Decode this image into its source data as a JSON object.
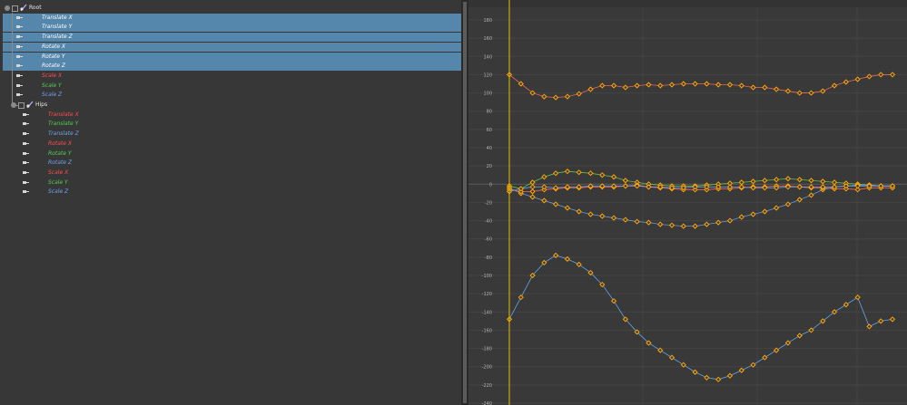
{
  "outliner": {
    "nodes": [
      {
        "name": "Root",
        "channels": [
          {
            "label": "Translate X",
            "axis": "x",
            "selected": true
          },
          {
            "label": "Translate Y",
            "axis": "y",
            "selected": true
          },
          {
            "label": "Translate Z",
            "axis": "z",
            "selected": true
          },
          {
            "label": "Rotate X",
            "axis": "x",
            "selected": true
          },
          {
            "label": "Rotate Y",
            "axis": "y",
            "selected": true
          },
          {
            "label": "Rotate Z",
            "axis": "z",
            "selected": true
          },
          {
            "label": "Scale X",
            "axis": "x",
            "selected": false
          },
          {
            "label": "Scale Y",
            "axis": "y",
            "selected": false
          },
          {
            "label": "Scale Z",
            "axis": "z",
            "selected": false
          }
        ]
      },
      {
        "name": "Hips",
        "channels": [
          {
            "label": "Translate X",
            "axis": "x",
            "selected": false
          },
          {
            "label": "Translate Y",
            "axis": "y",
            "selected": false
          },
          {
            "label": "Translate Z",
            "axis": "z",
            "selected": false
          },
          {
            "label": "Rotate X",
            "axis": "x",
            "selected": false
          },
          {
            "label": "Rotate Y",
            "axis": "y",
            "selected": false
          },
          {
            "label": "Rotate Z",
            "axis": "z",
            "selected": false
          },
          {
            "label": "Scale X",
            "axis": "x",
            "selected": false
          },
          {
            "label": "Scale Y",
            "axis": "y",
            "selected": false
          },
          {
            "label": "Scale Z",
            "axis": "z",
            "selected": false
          }
        ]
      }
    ],
    "colors": {
      "x": "#ff4e4e",
      "y": "#53ce53",
      "z": "#6fa3ef",
      "selection": "#5586ac"
    }
  },
  "graph_editor": {
    "y_ticks": [
      "180",
      "160",
      "140",
      "120",
      "100",
      "80",
      "60",
      "40",
      "20",
      "0",
      "-20",
      "-40",
      "-60",
      "-80",
      "-100",
      "-120",
      "-140",
      "-160",
      "-180",
      "-200",
      "-220",
      "-240"
    ],
    "current_frame_color": "#e8c000",
    "key_color": "#ffa500",
    "frames": [
      0,
      1,
      2,
      3,
      4,
      5,
      6,
      7,
      8,
      9,
      10,
      11,
      12,
      13,
      14,
      15,
      16,
      17,
      18,
      19,
      20,
      21,
      22,
      23,
      24,
      25,
      26,
      27,
      28,
      29,
      30,
      31,
      32,
      33
    ],
    "curves": [
      {
        "name": "Rotate Y",
        "color": "#69b0ff",
        "values": [
          -148,
          -124,
          -100,
          -86,
          -78,
          -82,
          -88,
          -97,
          -110,
          -128,
          -148,
          -162,
          -174,
          -182,
          -190,
          -198,
          -206,
          -212,
          -214,
          -210,
          -204,
          -198,
          -190,
          -182,
          -174,
          -166,
          -160,
          -150,
          -140,
          -132,
          -124,
          -156,
          -150,
          -148
        ]
      },
      {
        "name": "Rotate X",
        "color": "#ff6a6a",
        "values": [
          120,
          110,
          100,
          96,
          95,
          96,
          99,
          104,
          108,
          108,
          106,
          108,
          109,
          108,
          109,
          110,
          110,
          110,
          109,
          109,
          108,
          106,
          106,
          104,
          102,
          100,
          100,
          102,
          108,
          112,
          115,
          118,
          120,
          120
        ]
      },
      {
        "name": "Translate Y",
        "color": "#5fd25f",
        "values": [
          -2,
          -5,
          2,
          8,
          12,
          14,
          13,
          12,
          10,
          8,
          4,
          2,
          0,
          -1,
          -2,
          -2,
          -2,
          -1,
          0,
          1,
          2,
          3,
          4,
          5,
          6,
          5,
          4,
          3,
          2,
          1,
          0,
          -1,
          -2,
          -2
        ]
      },
      {
        "name": "Translate Z",
        "color": "#6fa3ef",
        "values": [
          -4,
          -10,
          -14,
          -18,
          -22,
          -26,
          -30,
          -33,
          -35,
          -37,
          -39,
          -41,
          -42,
          -44,
          -45,
          -46,
          -46,
          -44,
          -42,
          -40,
          -36,
          -33,
          -30,
          -26,
          -22,
          -17,
          -12,
          -6,
          -3,
          -2,
          -1,
          -1,
          -2,
          -2
        ]
      },
      {
        "name": "Translate X",
        "color": "#ff6a6a",
        "values": [
          -6,
          -8,
          -8,
          -6,
          -5,
          -4,
          -4,
          -3,
          -3,
          -3,
          -2,
          -1,
          -3,
          -4,
          -5,
          -6,
          -6,
          -6,
          -5,
          -5,
          -4,
          -3,
          -3,
          -2,
          -2,
          -3,
          -4,
          -4,
          -5,
          -5,
          -6,
          -4,
          -4,
          -4
        ]
      },
      {
        "name": "Rotate Z",
        "color": "#6fa3ef",
        "values": [
          -8,
          -5,
          -3,
          -3,
          -4,
          -3,
          -3,
          -2,
          -2,
          -2,
          -2,
          -2,
          -3,
          -3,
          -4,
          -4,
          -3,
          -3,
          -3,
          -3,
          -3,
          -4,
          -4,
          -4,
          -3,
          -3,
          -3,
          -3,
          -3,
          -2,
          -2,
          -2,
          -2,
          -2
        ]
      }
    ]
  }
}
